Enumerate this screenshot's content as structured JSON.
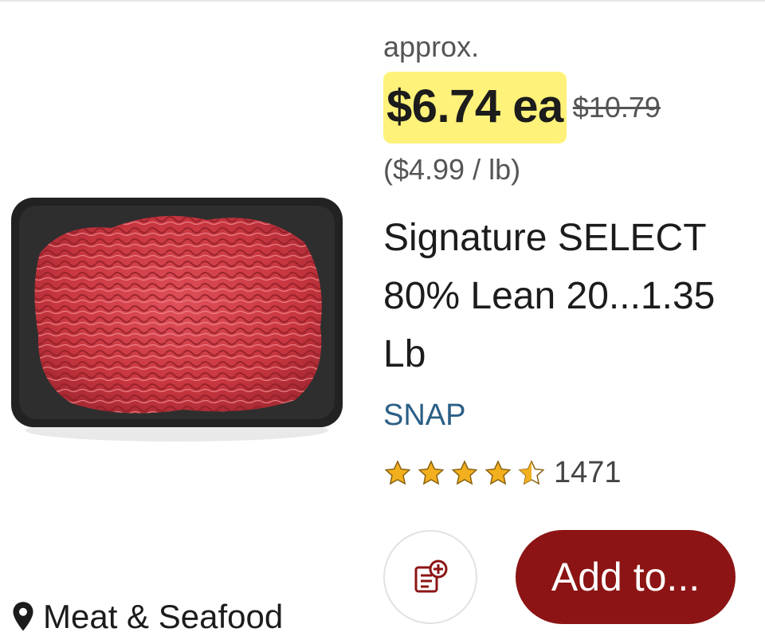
{
  "product": {
    "approx_label": "approx.",
    "price": "$6.74 ea",
    "was_price": "$10.79",
    "unit_price": "($4.99 / lb)",
    "title": "Signature SELECT 80% Lean 20...1.35 Lb",
    "snap_label": "SNAP",
    "rating": {
      "stars": 4.5,
      "max": 5,
      "count": "1471"
    },
    "image_icon": "ground-beef-photo"
  },
  "actions": {
    "list_icon": "add-to-list-icon",
    "add_label": "Add to..."
  },
  "aisle": {
    "icon": "location-pin-icon",
    "label": "Meat & Seafood"
  },
  "colors": {
    "price_highlight": "#fff27a",
    "add_button": "#8c1414",
    "snap": "#2b5f86",
    "star": "#f2b01e"
  }
}
